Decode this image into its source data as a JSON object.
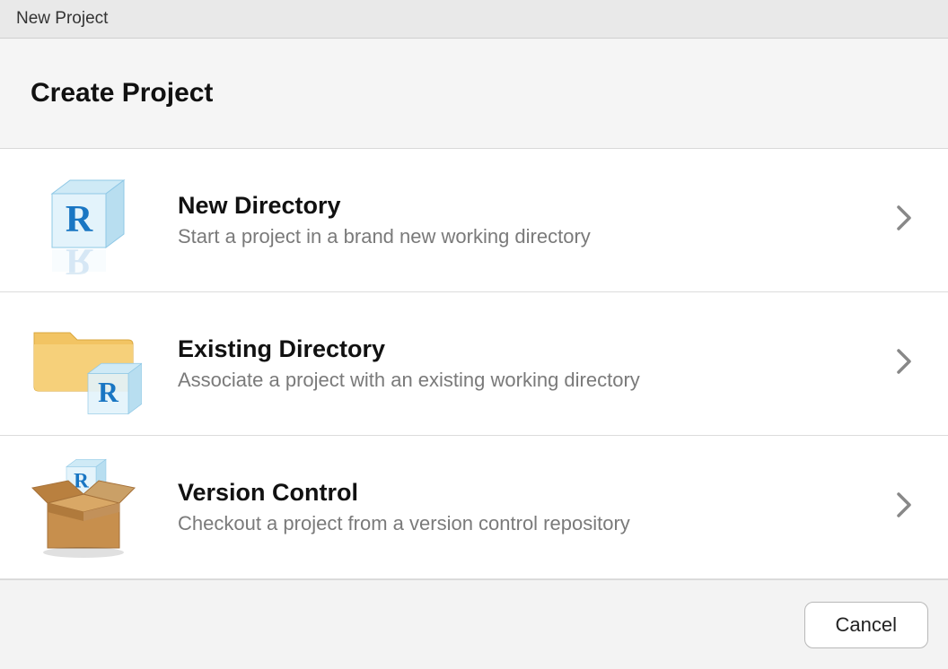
{
  "window": {
    "title": "New Project"
  },
  "header": {
    "title": "Create Project"
  },
  "options": [
    {
      "icon": "r-cube-icon",
      "title": "New Directory",
      "description": "Start a project in a brand new working directory"
    },
    {
      "icon": "folder-r-cube-icon",
      "title": "Existing Directory",
      "description": "Associate a project with an existing working directory"
    },
    {
      "icon": "box-r-cube-icon",
      "title": "Version Control",
      "description": "Checkout a project from a version control repository"
    }
  ],
  "footer": {
    "cancel_label": "Cancel"
  }
}
